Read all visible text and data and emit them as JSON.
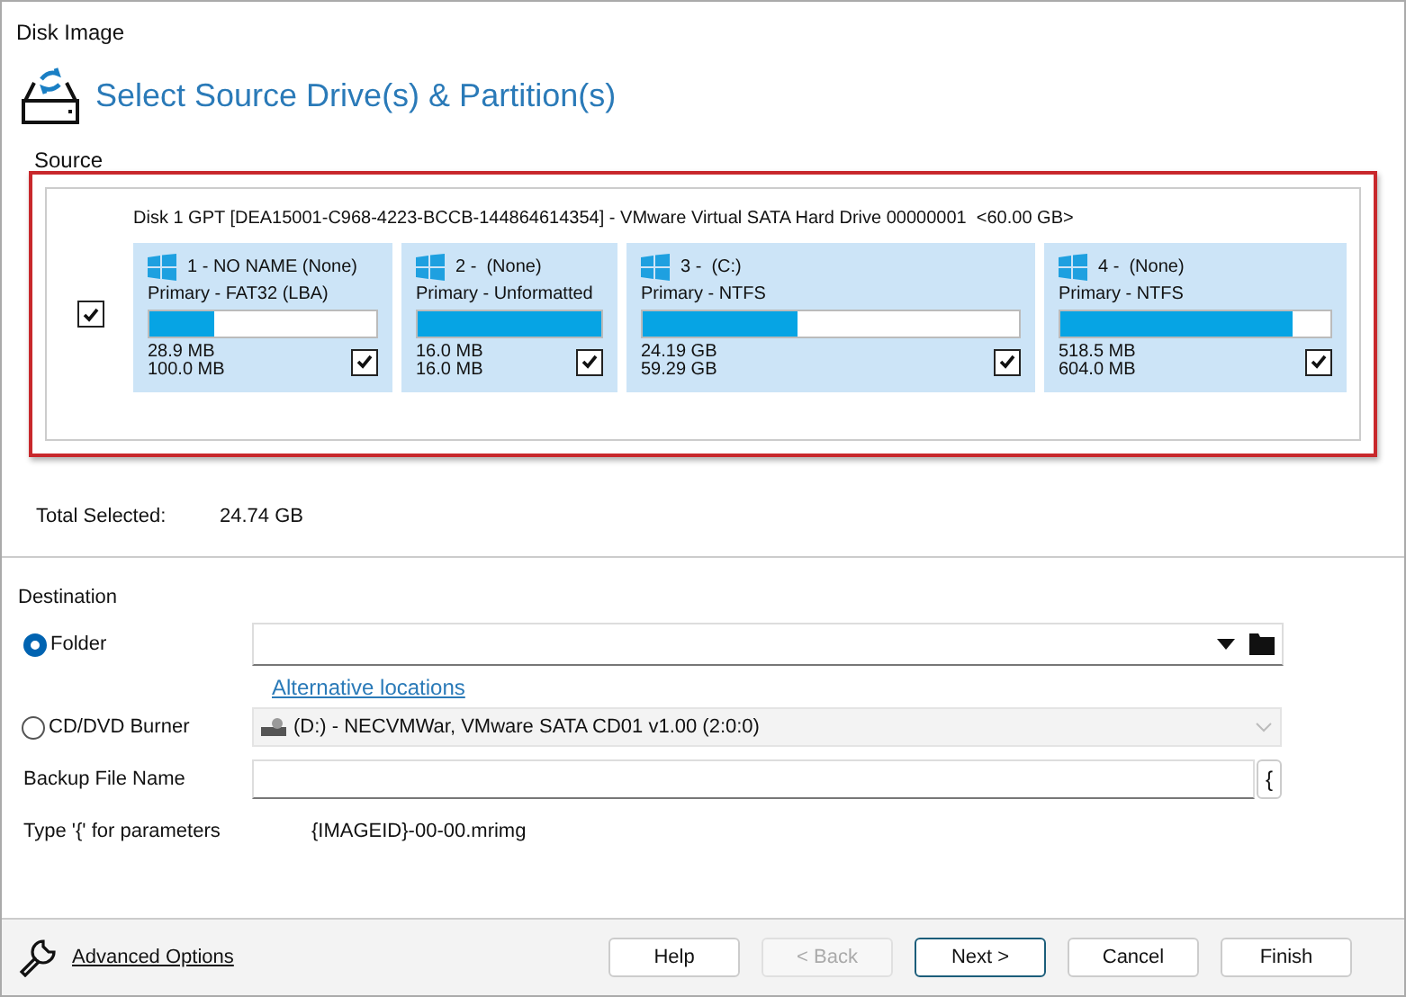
{
  "window": {
    "title": "Disk Image"
  },
  "header": {
    "title": "Select Source Drive(s) & Partition(s)"
  },
  "source": {
    "label": "Source",
    "disk": {
      "checked": true,
      "title": "Disk 1 GPT [DEA15001-C968-4223-BCCB-144864614354] - VMware Virtual SATA Hard Drive 00000001  <60.00 GB>",
      "partitions": [
        {
          "name": "1 - NO NAME (None)",
          "type": "Primary - FAT32 (LBA)",
          "level": 0.289,
          "used": "28.9 MB",
          "total": "100.0 MB",
          "checked": true
        },
        {
          "name": "2 -  (None)",
          "type": "Primary - Unformatted",
          "level": 1,
          "used": "16.0 MB",
          "total": "16.0 MB",
          "checked": true
        },
        {
          "name": "3 -  (C:)",
          "type": "Primary - NTFS",
          "level": 0.41,
          "used": "24.19 GB",
          "total": "59.29 GB",
          "checked": true
        },
        {
          "name": "4 -  (None)",
          "type": "Primary - NTFS",
          "level": 0.86,
          "used": "518.5 MB",
          "total": "604.0 MB",
          "checked": true
        }
      ]
    }
  },
  "total_selected": {
    "label": "Total Selected:",
    "value": "24.74 GB"
  },
  "destination": {
    "label": "Destination",
    "options": [
      {
        "label": "Folder",
        "selected": true
      },
      {
        "label": "CD/DVD Burner",
        "selected": false
      }
    ],
    "alternative_link": "Alternative locations",
    "burner": {
      "value": "(D:) - NECVMWar, VMware SATA CD01 v1.00 (2:0:0)",
      "disabled": true
    },
    "backup_file_name": {
      "label": "Backup File Name",
      "param_button": "{"
    },
    "parameters_hint": {
      "label": "Type '{' for parameters",
      "value": "{IMAGEID}-00-00.mrimg"
    }
  },
  "footer": {
    "advanced_link": "Advanced Options",
    "buttons": [
      {
        "label": "Help",
        "disabled": false,
        "default": false
      },
      {
        "label": "< Back",
        "disabled": true,
        "default": false
      },
      {
        "label": "Next >",
        "disabled": false,
        "default": true
      },
      {
        "label": "Cancel",
        "disabled": false,
        "default": false
      },
      {
        "label": "Finish",
        "disabled": false,
        "default": false
      }
    ]
  }
}
